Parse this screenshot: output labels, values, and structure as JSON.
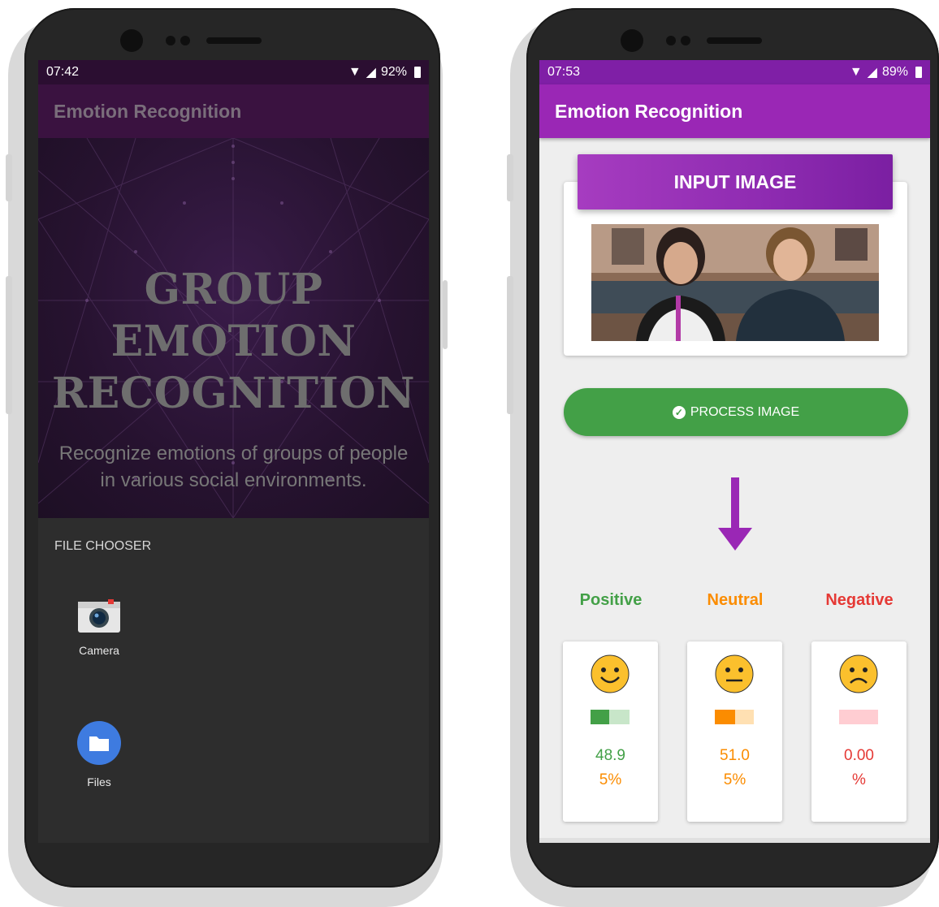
{
  "left_phone": {
    "status": {
      "time": "07:42",
      "battery": "92%"
    },
    "app_title": "Emotion Recognition",
    "hero": {
      "title_lines": [
        "GROUP",
        "EMOTION",
        "RECOGNITION"
      ],
      "subtitle_lines": [
        "Recognize emotions of groups of people",
        "in various social environments."
      ]
    },
    "chooser": {
      "title": "FILE CHOOSER",
      "apps": [
        {
          "label": "Camera",
          "icon": "camera-icon"
        },
        {
          "label": "Files",
          "icon": "folder-icon"
        }
      ]
    }
  },
  "right_phone": {
    "status": {
      "time": "07:53",
      "battery": "89%"
    },
    "app_title": "Emotion Recognition",
    "input_header": "INPUT IMAGE",
    "process_button": "PROCESS IMAGE",
    "emotions": [
      {
        "label": "Positive",
        "value_line1": "48.9",
        "value_line2": "5%",
        "color": "#43a047",
        "share": 0.4895
      },
      {
        "label": "Neutral",
        "value_line1": "51.0",
        "value_line2": "5%",
        "color": "#fb8c00",
        "share": 0.5105
      },
      {
        "label": "Negative",
        "value_line1": "0.00",
        "value_line2": "%",
        "color": "#e53935",
        "share": 0.0
      }
    ]
  },
  "colors": {
    "accent_purple": "#9a27b5",
    "process_green": "#43a047"
  }
}
